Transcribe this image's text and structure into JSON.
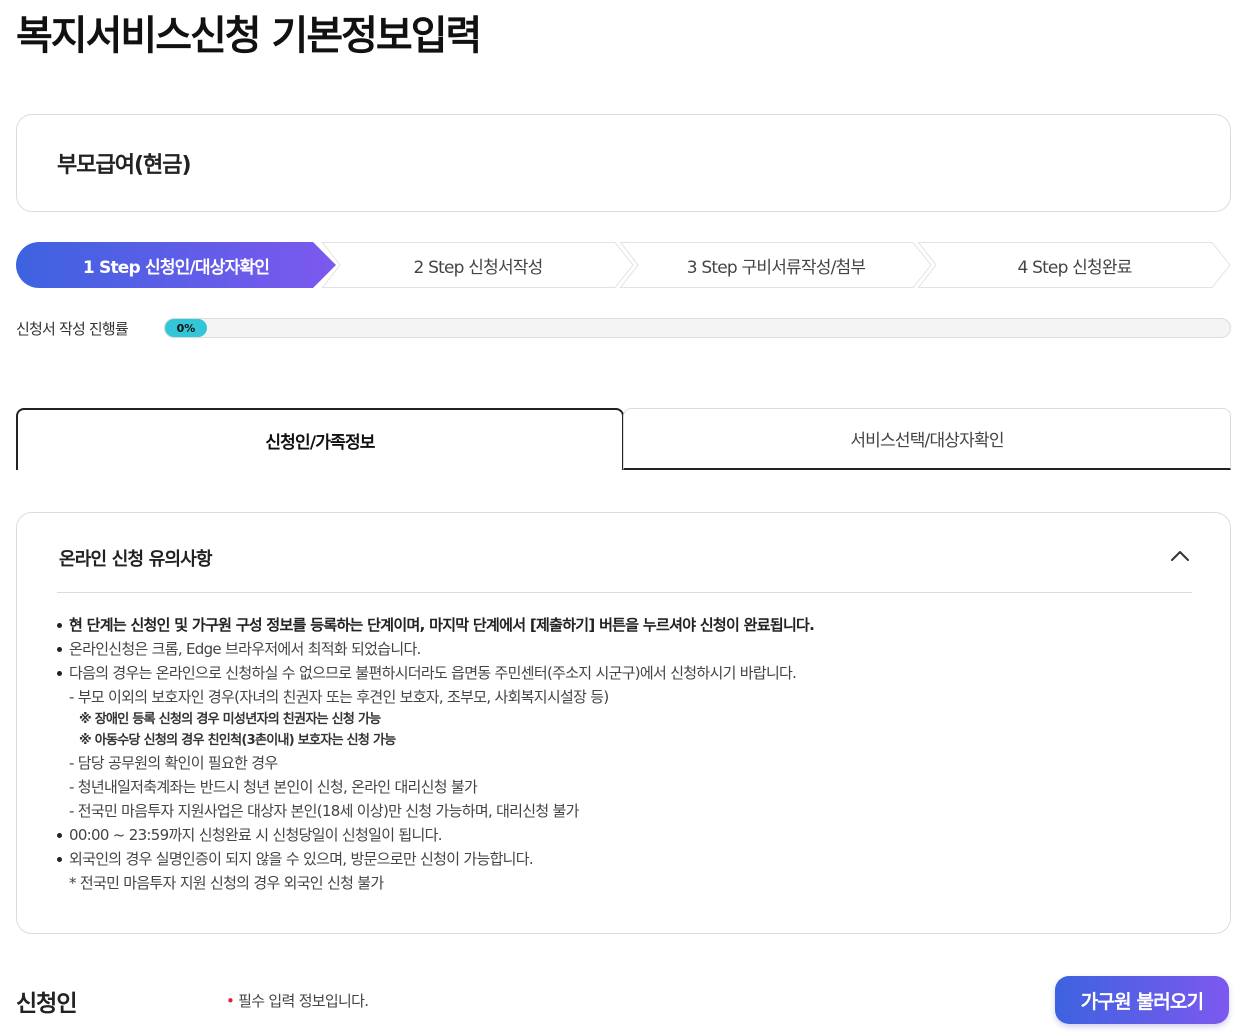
{
  "page": {
    "title": "복지서비스신청 기본정보입력"
  },
  "service": {
    "name": "부모급여(현금)"
  },
  "steps": [
    {
      "label": "1 Step 신청인/대상자확인",
      "active": true
    },
    {
      "label": "2 Step 신청서작성",
      "active": false
    },
    {
      "label": "3 Step 구비서류작성/첨부",
      "active": false
    },
    {
      "label": "4 Step 신청완료",
      "active": false
    }
  ],
  "progress": {
    "label": "신청서 작성 진행률",
    "value": 0,
    "text": "0%",
    "color": "#33c6d8"
  },
  "tabs": [
    {
      "label": "신청인/가족정보",
      "active": true
    },
    {
      "label": "서비스선택/대상자확인",
      "active": false
    }
  ],
  "notice": {
    "title": "온라인 신청 유의사항",
    "toggle_icon": "chevron-up-icon",
    "lines": [
      "현 단계는 신청인 및 가구원 구성 정보를 등록하는 단계이며, 마지막 단계에서 [제출하기] 버튼을 누르셔야 신청이 완료됩니다.",
      "온라인신청은 크롬, Edge 브라우저에서 최적화 되었습니다.",
      "다음의 경우는 온라인으로 신청하실 수 없으므로 불편하시더라도 읍면동 주민센터(주소지 시군구)에서 신청하시기 바랍니다.",
      "- 부모 이외의 보호자인 경우(자녀의 친권자 또는 후견인 보호자, 조부모, 사회복지시설장 등)",
      "※ 장애인 등록 신청의 경우 미성년자의 친권자는 신청 가능",
      "※ 아동수당 신청의 경우 친인척(3촌이내) 보호자는 신청 가능",
      "- 담당 공무원의 확인이 필요한 경우",
      "- 청년내일저축계좌는 반드시 청년 본인이 신청, 온라인 대리신청 불가",
      "- 전국민 마음투자 지원사업은 대상자 본인(18세 이상)만 신청 가능하며, 대리신청 불가",
      "00:00 ~ 23:59까지 신청완료 시 신청당일이 신청일이 됩니다.",
      "외국인의 경우 실명인증이 되지 않을 수 있으며, 방문으로만 신청이 가능합니다.",
      "* 전국민 마음투자 지원 신청의 경우 외국인 신청 불가"
    ]
  },
  "applicant": {
    "title": "신청인",
    "required_mark": "•",
    "required_note": "필수 입력 정보입니다.",
    "required_color": "#e0233a"
  },
  "family_button": {
    "label": "가구원 불러오기"
  },
  "colors": {
    "accent_start": "#3d63e0",
    "accent_end": "#7d58ef"
  }
}
